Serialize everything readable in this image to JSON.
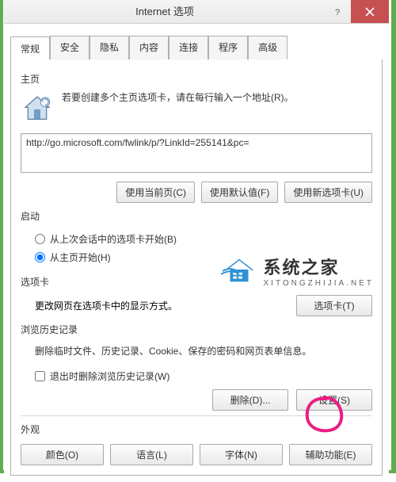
{
  "window": {
    "title": "Internet 选项"
  },
  "tabs": [
    "常规",
    "安全",
    "隐私",
    "内容",
    "连接",
    "程序",
    "高级"
  ],
  "homepage": {
    "section_label": "主页",
    "instruction": "若要创建多个主页选项卡，请在每行输入一个地址(R)。",
    "url_value": "http://go.microsoft.com/fwlink/p/?LinkId=255141&pc=",
    "btn_current": "使用当前页(C)",
    "btn_default": "使用默认值(F)",
    "btn_newtab": "使用新选项卡(U)"
  },
  "startup": {
    "section_label": "启动",
    "radio_last": "从上次会话中的选项卡开始(B)",
    "radio_home": "从主页开始(H)"
  },
  "tabs_section": {
    "section_label": "选项卡",
    "desc": "更改网页在选项卡中的显示方式。",
    "btn": "选项卡(T)"
  },
  "history": {
    "section_label": "浏览历史记录",
    "desc": "删除临时文件、历史记录、Cookie、保存的密码和网页表单信息。",
    "checkbox": "退出时删除浏览历史记录(W)",
    "btn_delete": "删除(D)...",
    "btn_settings": "设置(S)"
  },
  "appearance": {
    "section_label": "外观",
    "btn_color": "颜色(O)",
    "btn_lang": "语言(L)",
    "btn_font": "字体(N)",
    "btn_access": "辅助功能(E)"
  },
  "watermark": {
    "name": "系统之家",
    "url": "XITONGZHIJIA.NET"
  }
}
